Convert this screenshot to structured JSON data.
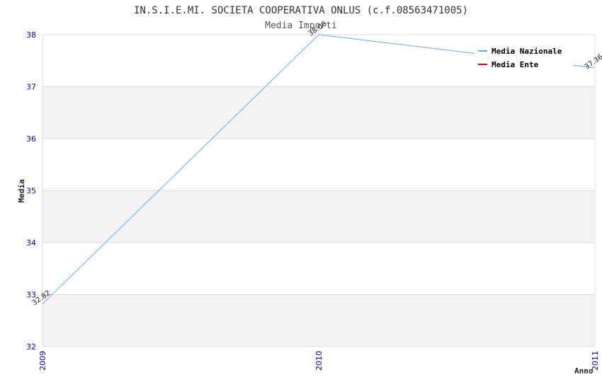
{
  "chart_data": {
    "type": "line",
    "title": "IN.S.I.E.MI. SOCIETA COOPERATIVA ONLUS (c.f.08563471005)",
    "subtitle": "Media Importi",
    "xlabel": "Anno",
    "ylabel": "Media",
    "x": [
      "2009",
      "2010",
      "2011"
    ],
    "ylim": [
      32,
      38
    ],
    "yticks": [
      "32",
      "33",
      "34",
      "35",
      "36",
      "37",
      "38"
    ],
    "grid": true,
    "legend_position": "top-right",
    "series": [
      {
        "name": "Media Nazionale",
        "color": "#66aaee",
        "values": [
          32.82,
          38.0,
          37.36
        ],
        "labels": [
          "32.82",
          "38.00",
          "37.36"
        ]
      },
      {
        "name": "Media Ente",
        "color": "#dd0000",
        "values": [],
        "labels": []
      }
    ]
  }
}
